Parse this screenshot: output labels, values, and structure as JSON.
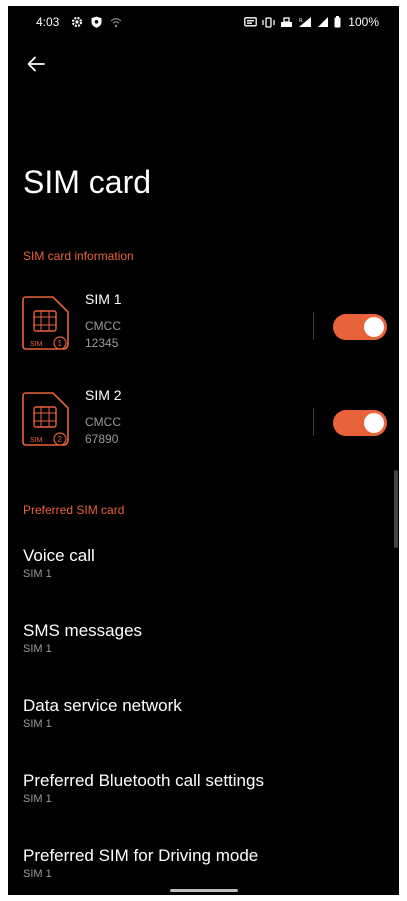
{
  "status_bar": {
    "time": "4:03",
    "battery_percent": "100%",
    "left_icons": [
      "gear-icon",
      "shield-icon",
      "wifi-icon"
    ],
    "right_icons": [
      "cast-icon",
      "vibrate-icon",
      "hotspot-icon",
      "signal-icon",
      "signal-icon-2",
      "battery-icon"
    ]
  },
  "header": {
    "back_icon": "arrow-left-icon",
    "title": "SIM card"
  },
  "sections": {
    "sim_info_header": "SIM card information",
    "preferred_header": "Preferred SIM card"
  },
  "sims": [
    {
      "name": "SIM 1",
      "carrier": "CMCC",
      "number": "12345",
      "icon_label": "SIM",
      "icon_number": "1",
      "enabled": true
    },
    {
      "name": "SIM 2",
      "carrier": "CMCC",
      "number": "67890",
      "icon_label": "SIM",
      "icon_number": "2",
      "enabled": true
    }
  ],
  "preferred": [
    {
      "title": "Voice call",
      "value": "SIM 1"
    },
    {
      "title": "SMS messages",
      "value": "SIM 1"
    },
    {
      "title": "Data service network",
      "value": "SIM 1"
    },
    {
      "title": "Preferred Bluetooth call settings",
      "value": "SIM 1"
    },
    {
      "title": "Preferred SIM for Driving mode",
      "value": "SIM 1"
    }
  ],
  "colors": {
    "accent": "#e8623a",
    "background": "#000000",
    "text_primary": "#ffffff",
    "text_secondary": "#9a9a9a"
  }
}
